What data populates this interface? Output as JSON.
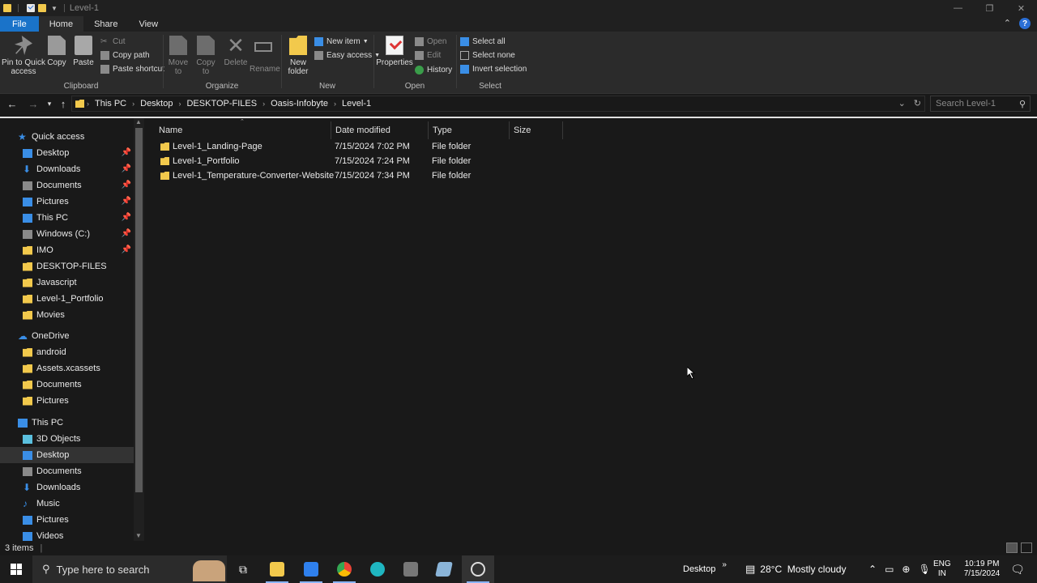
{
  "window": {
    "title": "Level-1",
    "controls": [
      "—",
      "❐",
      "✕"
    ]
  },
  "tabs": {
    "file": "File",
    "home": "Home",
    "share": "Share",
    "view": "View"
  },
  "ribbon": {
    "clipboard": {
      "label": "Clipboard",
      "pin": "Pin to Quick access",
      "copy": "Copy",
      "paste": "Paste",
      "cut": "Cut",
      "copy_path": "Copy path",
      "paste_shortcut": "Paste shortcut"
    },
    "organize": {
      "label": "Organize",
      "move_to": "Move to",
      "copy_to": "Copy to",
      "delete": "Delete",
      "rename": "Rename"
    },
    "new": {
      "label": "New",
      "new_folder": "New folder",
      "new_item": "New item",
      "easy_access": "Easy access"
    },
    "open": {
      "label": "Open",
      "properties": "Properties",
      "open": "Open",
      "edit": "Edit",
      "history": "History"
    },
    "select": {
      "label": "Select",
      "select_all": "Select all",
      "select_none": "Select none",
      "invert": "Invert selection"
    }
  },
  "address": {
    "crumbs": [
      "This PC",
      "Desktop",
      "DESKTOP-FILES",
      "Oasis-Infobyte",
      "Level-1"
    ],
    "search_placeholder": "Search Level-1"
  },
  "nav": {
    "quick_access": "Quick access",
    "quick_items": [
      "Desktop",
      "Downloads",
      "Documents",
      "Pictures",
      "This PC",
      "Windows (C:)",
      "IMO",
      "DESKTOP-FILES",
      "Javascript",
      "Level-1_Portfolio",
      "Movies"
    ],
    "onedrive": "OneDrive",
    "onedrive_items": [
      "android",
      "Assets.xcassets",
      "Documents",
      "Pictures"
    ],
    "this_pc": "This PC",
    "pc_items": [
      "3D Objects",
      "Desktop",
      "Documents",
      "Downloads",
      "Music",
      "Pictures",
      "Videos"
    ]
  },
  "columns": {
    "name": "Name",
    "date": "Date modified",
    "type": "Type",
    "size": "Size"
  },
  "files": [
    {
      "name": "Level-1_Landing-Page",
      "date": "7/15/2024 7:02 PM",
      "type": "File folder"
    },
    {
      "name": "Level-1_Portfolio",
      "date": "7/15/2024 7:24 PM",
      "type": "File folder"
    },
    {
      "name": "Level-1_Temperature-Converter-Website",
      "date": "7/15/2024 7:34 PM",
      "type": "File folder"
    }
  ],
  "status": {
    "count": "3 items"
  },
  "taskbar": {
    "search_placeholder": "Type here to search",
    "desktop_label": "Desktop",
    "weather": "28°C  Mostly cloudy",
    "lang1": "ENG",
    "lang2": "IN",
    "time": "10:19 PM",
    "date": "7/15/2024"
  }
}
